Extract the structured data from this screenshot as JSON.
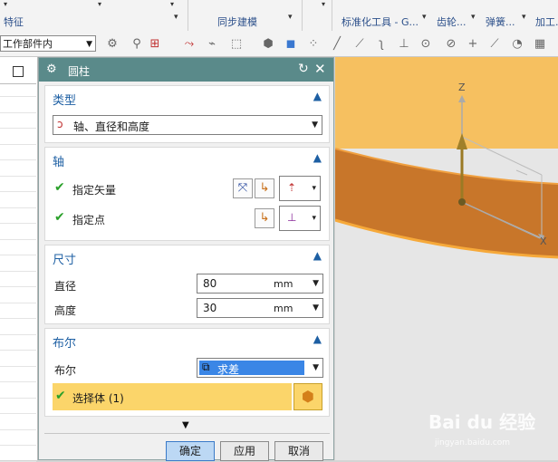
{
  "ribbon": {
    "group_features": "特征",
    "group_sync_modeling": "同步建模",
    "group_standard_tools": "标准化工具 - G...",
    "group_gear": "齿轮...",
    "group_spring": "弹簧...",
    "group_machining": "加工..."
  },
  "toolbar": {
    "scope_select": "工作部件内"
  },
  "dialog": {
    "title": "圆柱",
    "type_section": {
      "title": "类型",
      "value": "轴、直径和高度"
    },
    "axis_section": {
      "title": "轴",
      "specify_vector": "指定矢量",
      "specify_point": "指定点"
    },
    "size_section": {
      "title": "尺寸",
      "diameter_label": "直径",
      "diameter_value": "80",
      "diameter_unit": "mm",
      "height_label": "高度",
      "height_value": "30",
      "height_unit": "mm"
    },
    "boolean_section": {
      "title": "布尔",
      "label": "布尔",
      "value": "求差",
      "select_body": "选择体 (1)"
    },
    "buttons": {
      "ok": "确定",
      "apply": "应用",
      "cancel": "取消"
    }
  },
  "viewport": {
    "axis_z": "Z",
    "axis_x": "X",
    "colors": {
      "cylinder_top": "#f6c060",
      "cylinder_side": "#c8762a",
      "edge": "#f6a93a"
    }
  },
  "watermark": {
    "text": "Bai du 经验",
    "url": "jingyan.baidu.com"
  }
}
